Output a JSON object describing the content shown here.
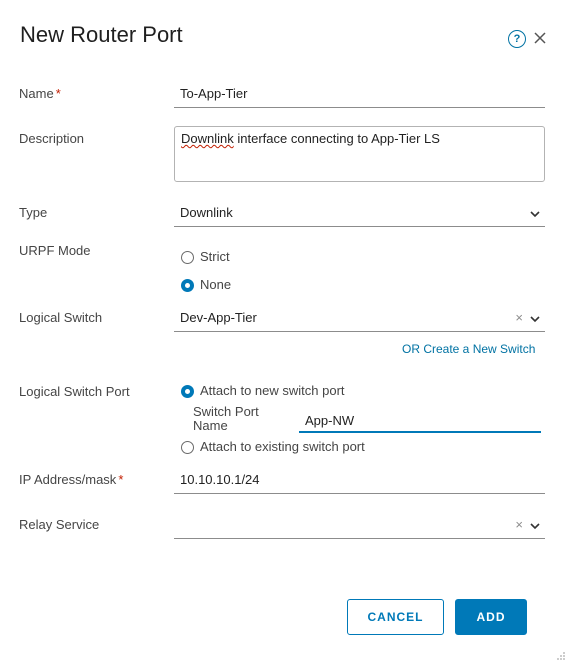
{
  "dialog": {
    "title": "New Router Port",
    "icons": {
      "help": "help-circle-icon",
      "close": "close-icon"
    }
  },
  "form": {
    "name": {
      "label": "Name",
      "required_mark": "*",
      "value": "To-App-Tier"
    },
    "description": {
      "label": "Description",
      "value_word1": "Downlink",
      "value_rest": " interface connecting to App-Tier LS"
    },
    "type": {
      "label": "Type",
      "value": "Downlink"
    },
    "urpf_mode": {
      "label": "URPF Mode",
      "options": [
        "Strict",
        "None"
      ],
      "selected": "None"
    },
    "logical_switch": {
      "label": "Logical Switch",
      "value": "Dev-App-Tier",
      "create_link": "OR Create a New Switch"
    },
    "logical_switch_port": {
      "label": "Logical Switch Port",
      "option_new": "Attach to new switch port",
      "option_existing": "Attach to existing switch port",
      "selected": "Attach to new switch port",
      "switch_port_name_label_line1": "Switch Port",
      "switch_port_name_label_line2": "Name",
      "switch_port_name_value": "App-NW"
    },
    "ip_address": {
      "label": "IP Address/mask",
      "required_mark": "*",
      "value": "10.10.10.1/24"
    },
    "relay_service": {
      "label": "Relay Service",
      "value": ""
    }
  },
  "footer": {
    "cancel_label": "CANCEL",
    "add_label": "ADD"
  },
  "colors": {
    "accent": "#0079b8",
    "link": "#0072a3",
    "required": "#c21d00"
  }
}
